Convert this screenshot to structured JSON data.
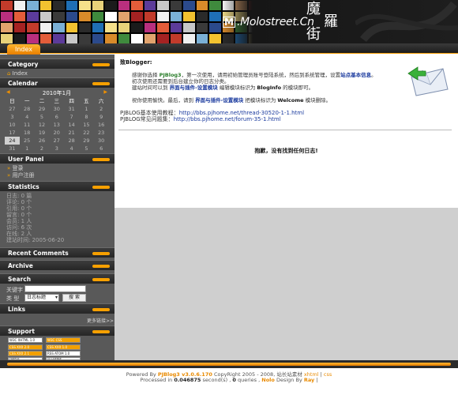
{
  "header": {
    "logo_mark": "M",
    "logo_text": ".Molostreet.Cn",
    "logo_cjk": [
      "魔",
      "羅",
      "街"
    ],
    "mosaic_colors": [
      "#c23b2b",
      "#e8d27a",
      "#2b4a8c",
      "#f0f0f0",
      "#1b1b1b",
      "#d98b2a",
      "#7ab0d6",
      "#b92f7e",
      "#3f8a3d",
      "#f2c230",
      "#e35d3a",
      "#ffffff",
      "#2a2a2a",
      "#5c3b9a",
      "#e2a36d",
      "#1f6fb5",
      "#c8c8c8",
      "#a52222",
      "#f5e08a",
      "#3a3a3a"
    ]
  },
  "nav": {
    "index_tab": "Index"
  },
  "sidebar": {
    "category": {
      "title": "Category",
      "items": [
        "Index"
      ]
    },
    "calendar": {
      "title": "Calendar",
      "month": "2010年1月",
      "weekdays": [
        "日",
        "一",
        "二",
        "三",
        "四",
        "五",
        "六"
      ],
      "days": [
        "27",
        "28",
        "29",
        "30",
        "31",
        "1",
        "2",
        "3",
        "4",
        "5",
        "6",
        "7",
        "8",
        "9",
        "10",
        "11",
        "12",
        "13",
        "14",
        "15",
        "16",
        "17",
        "18",
        "19",
        "20",
        "21",
        "22",
        "23",
        "24",
        "25",
        "26",
        "27",
        "28",
        "29",
        "30",
        "31",
        "1",
        "2",
        "3",
        "4",
        "5",
        "6"
      ],
      "today": "25"
    },
    "user_panel": {
      "title": "User Panel",
      "items": [
        "登录",
        "用户注册"
      ]
    },
    "statistics": {
      "title": "Statistics",
      "lines": [
        "日志: 0 篇",
        "评论: 0 个",
        "引用: 0 个",
        "留言: 0 个",
        "会员: 1 人",
        "访问: 6 次",
        "在线: 2 人",
        "建站时间: 2005-06-20"
      ]
    },
    "recent_comments": {
      "title": "Recent Comments"
    },
    "archive": {
      "title": "Archive"
    },
    "search": {
      "title": "Search",
      "keyword_label": "关键字",
      "keyword_value": "",
      "type_label": "类  型",
      "type_selected": "日志标题",
      "button": "搜 索"
    },
    "links": {
      "title": "Links",
      "more": "更多链接>>"
    },
    "support": {
      "title": "Support",
      "badges": [
        "W3C XHTML 1.0",
        "W3C CSS",
        "CSS XXX 2.0",
        "CSS XXX 1.0",
        "CSS XXX 2.1",
        "RSS ATOM 1.0",
        "FIREFOX",
        "CC LICENSE"
      ]
    }
  },
  "main": {
    "greeting": "致Blogger:",
    "para1": {
      "a": "感谢你选择 ",
      "brand": "PJBlog3",
      "b": "，第一次使用，请用初始管理员账号登陆系统，然后到系统管理，设置",
      "link": "站点基本信息",
      "c": "。"
    },
    "para1_line2": "初次使用还需要到后台建立你的日志分类。",
    "para1_line3": {
      "a": "建站时间可以到 ",
      "link": "界面与插件-设置模块",
      "b": " 编辑模块标识为 ",
      "key": "BlogInfo",
      "c": " 的模块即可。"
    },
    "para2": {
      "a": "祝你使用愉快。最后，请到 ",
      "link": "界面与插件-设置模块",
      "b": " 把模块标识为 ",
      "key": "Welcome",
      "c": " 模块删除。"
    },
    "tutorial_label": "PJBLOG基本使用教程：",
    "tutorial_url": "http://bbs.pjhome.net/thread-30520-1-1.html",
    "faq_label": "PJBLOG常见问题集：",
    "faq_url": "http://bbs.pjhome.net/forum-35-1.html",
    "no_entries": "抱歉，没有找到任何日志!"
  },
  "footer": {
    "line1": {
      "a": "Powered By ",
      "brand": "PJBlog3 v3.0.6.170",
      "b": " CopyRight 2005 - 2008, 站长站素材 ",
      "xhtml": "xhtml",
      "sep": " | ",
      "css": "css"
    },
    "line2": {
      "a": "Processed in ",
      "time": "0.046875",
      "b": " second(s) , ",
      "queries": "0",
      "c": " queries , ",
      "design_a": "Nolo",
      "d": " Design By ",
      "design_b": "Ray",
      "e": " |"
    }
  },
  "colors": {
    "accent": "#f29a00",
    "sidebar_bg": "#595959",
    "link": "#1a3a9e"
  }
}
